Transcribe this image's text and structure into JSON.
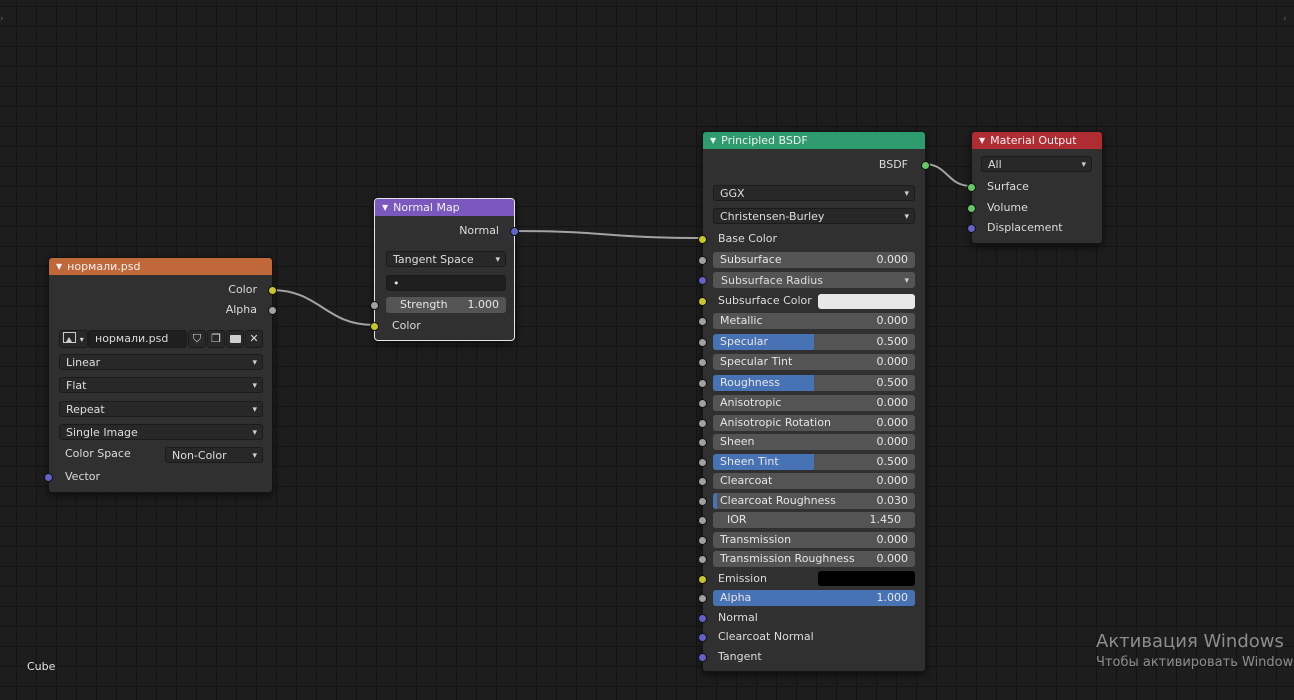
{
  "colors": {
    "image_header": "#c1683b",
    "normal_header": "#7a58bd",
    "bsdf_header": "#2e9b6e",
    "output_header": "#b02c33",
    "slider_fill": "#4772b3",
    "subsurface_color": "#e8e8e8",
    "emission_color": "#000000"
  },
  "image_node": {
    "title": "нормали.psd",
    "out_color": "Color",
    "out_alpha": "Alpha",
    "image_name": "нормали.psd",
    "interpolation": "Linear",
    "projection": "Flat",
    "extension": "Repeat",
    "source": "Single Image",
    "color_space_label": "Color Space",
    "color_space": "Non-Color",
    "in_vector": "Vector"
  },
  "normal_map_node": {
    "title": "Normal Map",
    "out_normal": "Normal",
    "space": "Tangent Space",
    "uv_placeholder": "•",
    "strength_label": "Strength",
    "strength_value": "1.000",
    "strength_fraction": 0.0,
    "in_color": "Color"
  },
  "bsdf_node": {
    "title": "Principled BSDF",
    "out_bsdf": "BSDF",
    "distribution": "GGX",
    "subsurface_method": "Christensen-Burley",
    "base_color": "Base Color",
    "subsurface": {
      "label": "Subsurface",
      "value": "0.000",
      "fraction": 0.0
    },
    "subsurface_radius": "Subsurface Radius",
    "subsurface_color": "Subsurface Color",
    "metallic": {
      "label": "Metallic",
      "value": "0.000",
      "fraction": 0.0
    },
    "specular": {
      "label": "Specular",
      "value": "0.500",
      "fraction": 0.5
    },
    "specular_tint": {
      "label": "Specular Tint",
      "value": "0.000",
      "fraction": 0.0
    },
    "roughness": {
      "label": "Roughness",
      "value": "0.500",
      "fraction": 0.5
    },
    "anisotropic": {
      "label": "Anisotropic",
      "value": "0.000",
      "fraction": 0.0
    },
    "anisotropic_rotation": {
      "label": "Anisotropic Rotation",
      "value": "0.000",
      "fraction": 0.0
    },
    "sheen": {
      "label": "Sheen",
      "value": "0.000",
      "fraction": 0.0
    },
    "sheen_tint": {
      "label": "Sheen Tint",
      "value": "0.500",
      "fraction": 0.5
    },
    "clearcoat": {
      "label": "Clearcoat",
      "value": "0.000",
      "fraction": 0.0
    },
    "clearcoat_roughness": {
      "label": "Clearcoat Roughness",
      "value": "0.030",
      "fraction": 0.03
    },
    "ior": {
      "label": "IOR",
      "value": "1.450"
    },
    "transmission": {
      "label": "Transmission",
      "value": "0.000",
      "fraction": 0.0
    },
    "transmission_roughness": {
      "label": "Transmission Roughness",
      "value": "0.000",
      "fraction": 0.0
    },
    "emission": "Emission",
    "alpha": {
      "label": "Alpha",
      "value": "1.000",
      "fraction": 1.0
    },
    "normal": "Normal",
    "clearcoat_normal": "Clearcoat Normal",
    "tangent": "Tangent"
  },
  "output_node": {
    "title": "Material Output",
    "target": "All",
    "surface": "Surface",
    "volume": "Volume",
    "displacement": "Displacement"
  },
  "object_name": "Cube",
  "watermark": {
    "line1": "Активация Windows",
    "line2": "Чтобы активировать Window"
  },
  "icons": [
    "image-type-icon",
    "chevron-down-icon",
    "fake-user-shield-icon",
    "duplicate-icon",
    "folder-icon",
    "close-icon",
    "collapse-triangle-icon",
    "sidebar-toggle-icon"
  ]
}
